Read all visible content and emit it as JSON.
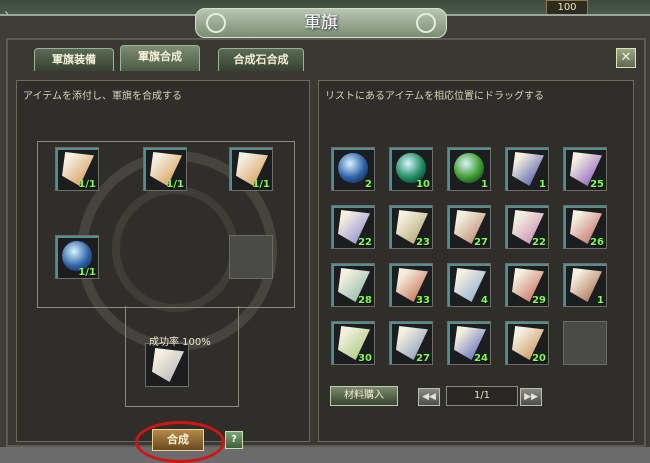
{
  "window": {
    "title": "軍旗",
    "corner_badge": "100",
    "left_text": "入"
  },
  "tabs": [
    {
      "label": "軍旗装備",
      "active": false
    },
    {
      "label": "軍旗合成",
      "active": true
    },
    {
      "label": "合成石合成",
      "active": false
    }
  ],
  "close_label": "✕",
  "left_panel": {
    "instruction": "アイテムを添付し、軍旗を合成する",
    "success_rate_label": "成功率 100%",
    "synthesize_button": "合成",
    "help_button": "?",
    "slots": [
      {
        "kind": "flag",
        "color": "#d79a55",
        "count": "1/1"
      },
      {
        "kind": "flag",
        "color": "#d79a55",
        "count": "1/1"
      },
      {
        "kind": "flag",
        "color": "#d79a55",
        "count": "1/1"
      },
      {
        "kind": "gem",
        "color": "#2f62a8",
        "count": "1/1"
      },
      {
        "kind": "empty",
        "color": "",
        "count": ""
      },
      {
        "kind": "result",
        "color": "#b8b8b8",
        "count": ""
      }
    ]
  },
  "right_panel": {
    "instruction": "リストにあるアイテムを相応位置にドラッグする",
    "buy_button": "材料購入",
    "page_prev": "◀◀",
    "page_next": "▶▶",
    "page_indicator": "1/1",
    "items": [
      {
        "kind": "gem",
        "color": "#2b5fa8",
        "count": "2"
      },
      {
        "kind": "gem",
        "color": "#1e8a5c",
        "count": "10"
      },
      {
        "kind": "gem",
        "color": "#3c9a2a",
        "count": "1"
      },
      {
        "kind": "flag",
        "color": "#4a55a8",
        "count": "1"
      },
      {
        "kind": "flag",
        "color": "#8a58c0",
        "count": "25"
      },
      {
        "kind": "flag",
        "color": "#8e8bd0",
        "count": "22"
      },
      {
        "kind": "flag",
        "color": "#b0a46a",
        "count": "23"
      },
      {
        "kind": "flag",
        "color": "#b8866a",
        "count": "27"
      },
      {
        "kind": "flag",
        "color": "#c78ab0",
        "count": "22"
      },
      {
        "kind": "flag",
        "color": "#c46a6a",
        "count": "26"
      },
      {
        "kind": "flag",
        "color": "#8ab8a8",
        "count": "28"
      },
      {
        "kind": "flag",
        "color": "#c86a50",
        "count": "33"
      },
      {
        "kind": "flag",
        "color": "#8aaecf",
        "count": "4"
      },
      {
        "kind": "flag",
        "color": "#c86a5a",
        "count": "29"
      },
      {
        "kind": "flag",
        "color": "#a86a4a",
        "count": "1"
      },
      {
        "kind": "flag",
        "color": "#a8c87a",
        "count": "30"
      },
      {
        "kind": "flag",
        "color": "#8a9ab8",
        "count": "27"
      },
      {
        "kind": "flag",
        "color": "#5a6ab8",
        "count": "24"
      },
      {
        "kind": "flag",
        "color": "#c8945a",
        "count": "20"
      },
      {
        "kind": "empty",
        "color": "",
        "count": ""
      }
    ]
  }
}
